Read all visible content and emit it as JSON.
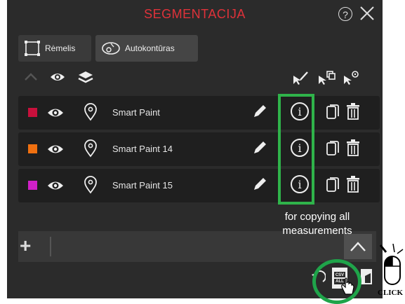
{
  "header": {
    "title": "SEGMENTACIJA",
    "help_label": "?"
  },
  "tabs": [
    {
      "label": "Rėmelis",
      "icon": "frame-icon"
    },
    {
      "label": "Autokontūras",
      "icon": "autocontour-icon"
    }
  ],
  "segments": [
    {
      "name": "Smart Paint",
      "color": "#c8103c"
    },
    {
      "name": "Smart Paint 14",
      "color": "#f07010"
    },
    {
      "name": "Smart Paint 15",
      "color": "#d020c8"
    }
  ],
  "info_label": "i",
  "annotation": "for copying all measurements",
  "add_label": "+",
  "csv_label": "CSV ALL",
  "click_label": "CLICK",
  "colors": {
    "accent": "#e0323a",
    "highlight": "#2fb34a",
    "panel": "#2b2b2b"
  }
}
